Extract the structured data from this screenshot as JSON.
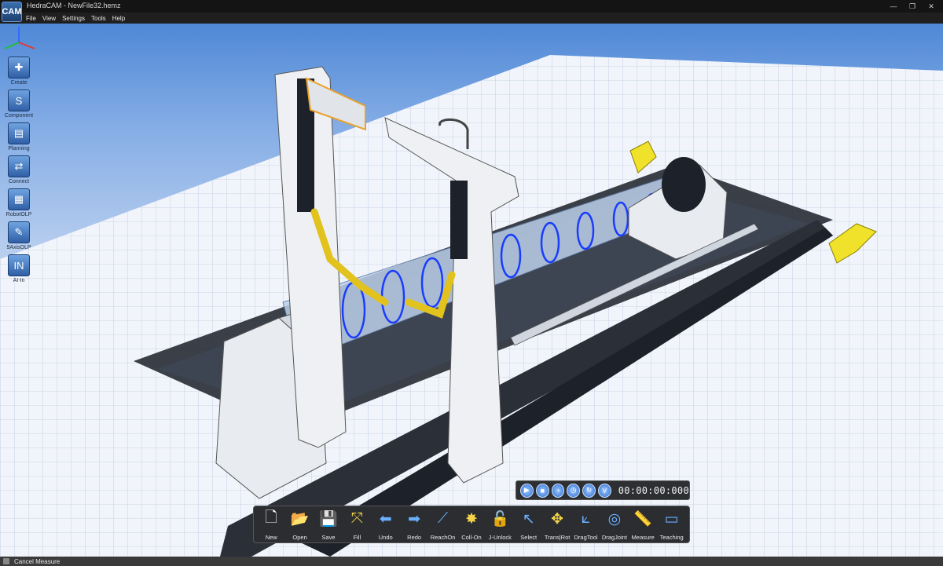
{
  "window": {
    "logo_text": "CAM",
    "title": "HedraCAM - NewFile32.hemz",
    "minimize": "—",
    "maximize": "❐",
    "close": "✕"
  },
  "menu": [
    "File",
    "View",
    "Settings",
    "Tools",
    "Help"
  ],
  "left_toolbar": [
    {
      "label": "Create",
      "icon": "create-icon",
      "glyph": "✚"
    },
    {
      "label": "Component",
      "icon": "component-icon",
      "glyph": "S"
    },
    {
      "label": "Planning",
      "icon": "planning-icon",
      "glyph": "▤"
    },
    {
      "label": "Connect",
      "icon": "connect-icon",
      "glyph": "⇄"
    },
    {
      "label": "RobotOLP",
      "icon": "robotolp-icon",
      "glyph": "▦"
    },
    {
      "label": "5AxisOLP",
      "icon": "fiveaxis-icon",
      "glyph": "✎"
    },
    {
      "label": "AI-In",
      "icon": "ai-in-icon",
      "glyph": "IN"
    }
  ],
  "playback": {
    "buttons": [
      {
        "name": "play",
        "glyph": "▶"
      },
      {
        "name": "stop",
        "glyph": "■"
      },
      {
        "name": "step",
        "glyph": "◔"
      },
      {
        "name": "time",
        "glyph": "◷"
      },
      {
        "name": "loop",
        "glyph": "↻"
      },
      {
        "name": "verify",
        "glyph": "V"
      }
    ],
    "time": "00:00:00:000"
  },
  "bottom_toolbar": [
    {
      "label": "New",
      "icon": "new-file-icon",
      "glyph": "🗋",
      "color": "#ffffff"
    },
    {
      "label": "Open",
      "icon": "open-folder-icon",
      "glyph": "📂",
      "color": "#6ab0ff"
    },
    {
      "label": "Save",
      "icon": "save-icon",
      "glyph": "💾",
      "color": "#ffffff"
    },
    {
      "label": "Fill",
      "icon": "fill-icon",
      "glyph": "⤧",
      "color": "#f5d547"
    },
    {
      "label": "Undo",
      "icon": "undo-icon",
      "glyph": "⬅",
      "color": "#6ab0ff"
    },
    {
      "label": "Redo",
      "icon": "redo-icon",
      "glyph": "➡",
      "color": "#6ab0ff"
    },
    {
      "label": "ReachOn",
      "icon": "reachon-icon",
      "glyph": "⟋",
      "color": "#6ab0ff"
    },
    {
      "label": "Coll-On",
      "icon": "collision-icon",
      "glyph": "✸",
      "color": "#f5d547"
    },
    {
      "label": "J-Unlock",
      "icon": "joint-unlock-icon",
      "glyph": "🔓",
      "color": "#f5d547"
    },
    {
      "label": "Select",
      "icon": "select-arrow-icon",
      "glyph": "↖",
      "color": "#6ab0ff"
    },
    {
      "label": "Trans|Rot",
      "icon": "transrot-icon",
      "glyph": "✥",
      "color": "#f5d547"
    },
    {
      "label": "DragTool",
      "icon": "dragtool-icon",
      "glyph": "⟀",
      "color": "#6ab0ff"
    },
    {
      "label": "DragJoint",
      "icon": "dragjoint-icon",
      "glyph": "◎",
      "color": "#6ab0ff"
    },
    {
      "label": "Measure",
      "icon": "measure-ruler-icon",
      "glyph": "📏",
      "color": "#6ab0ff"
    },
    {
      "label": "Teaching",
      "icon": "teaching-icon",
      "glyph": "▭",
      "color": "#6ab0ff"
    }
  ],
  "status": {
    "text": "Cancel Measure"
  }
}
